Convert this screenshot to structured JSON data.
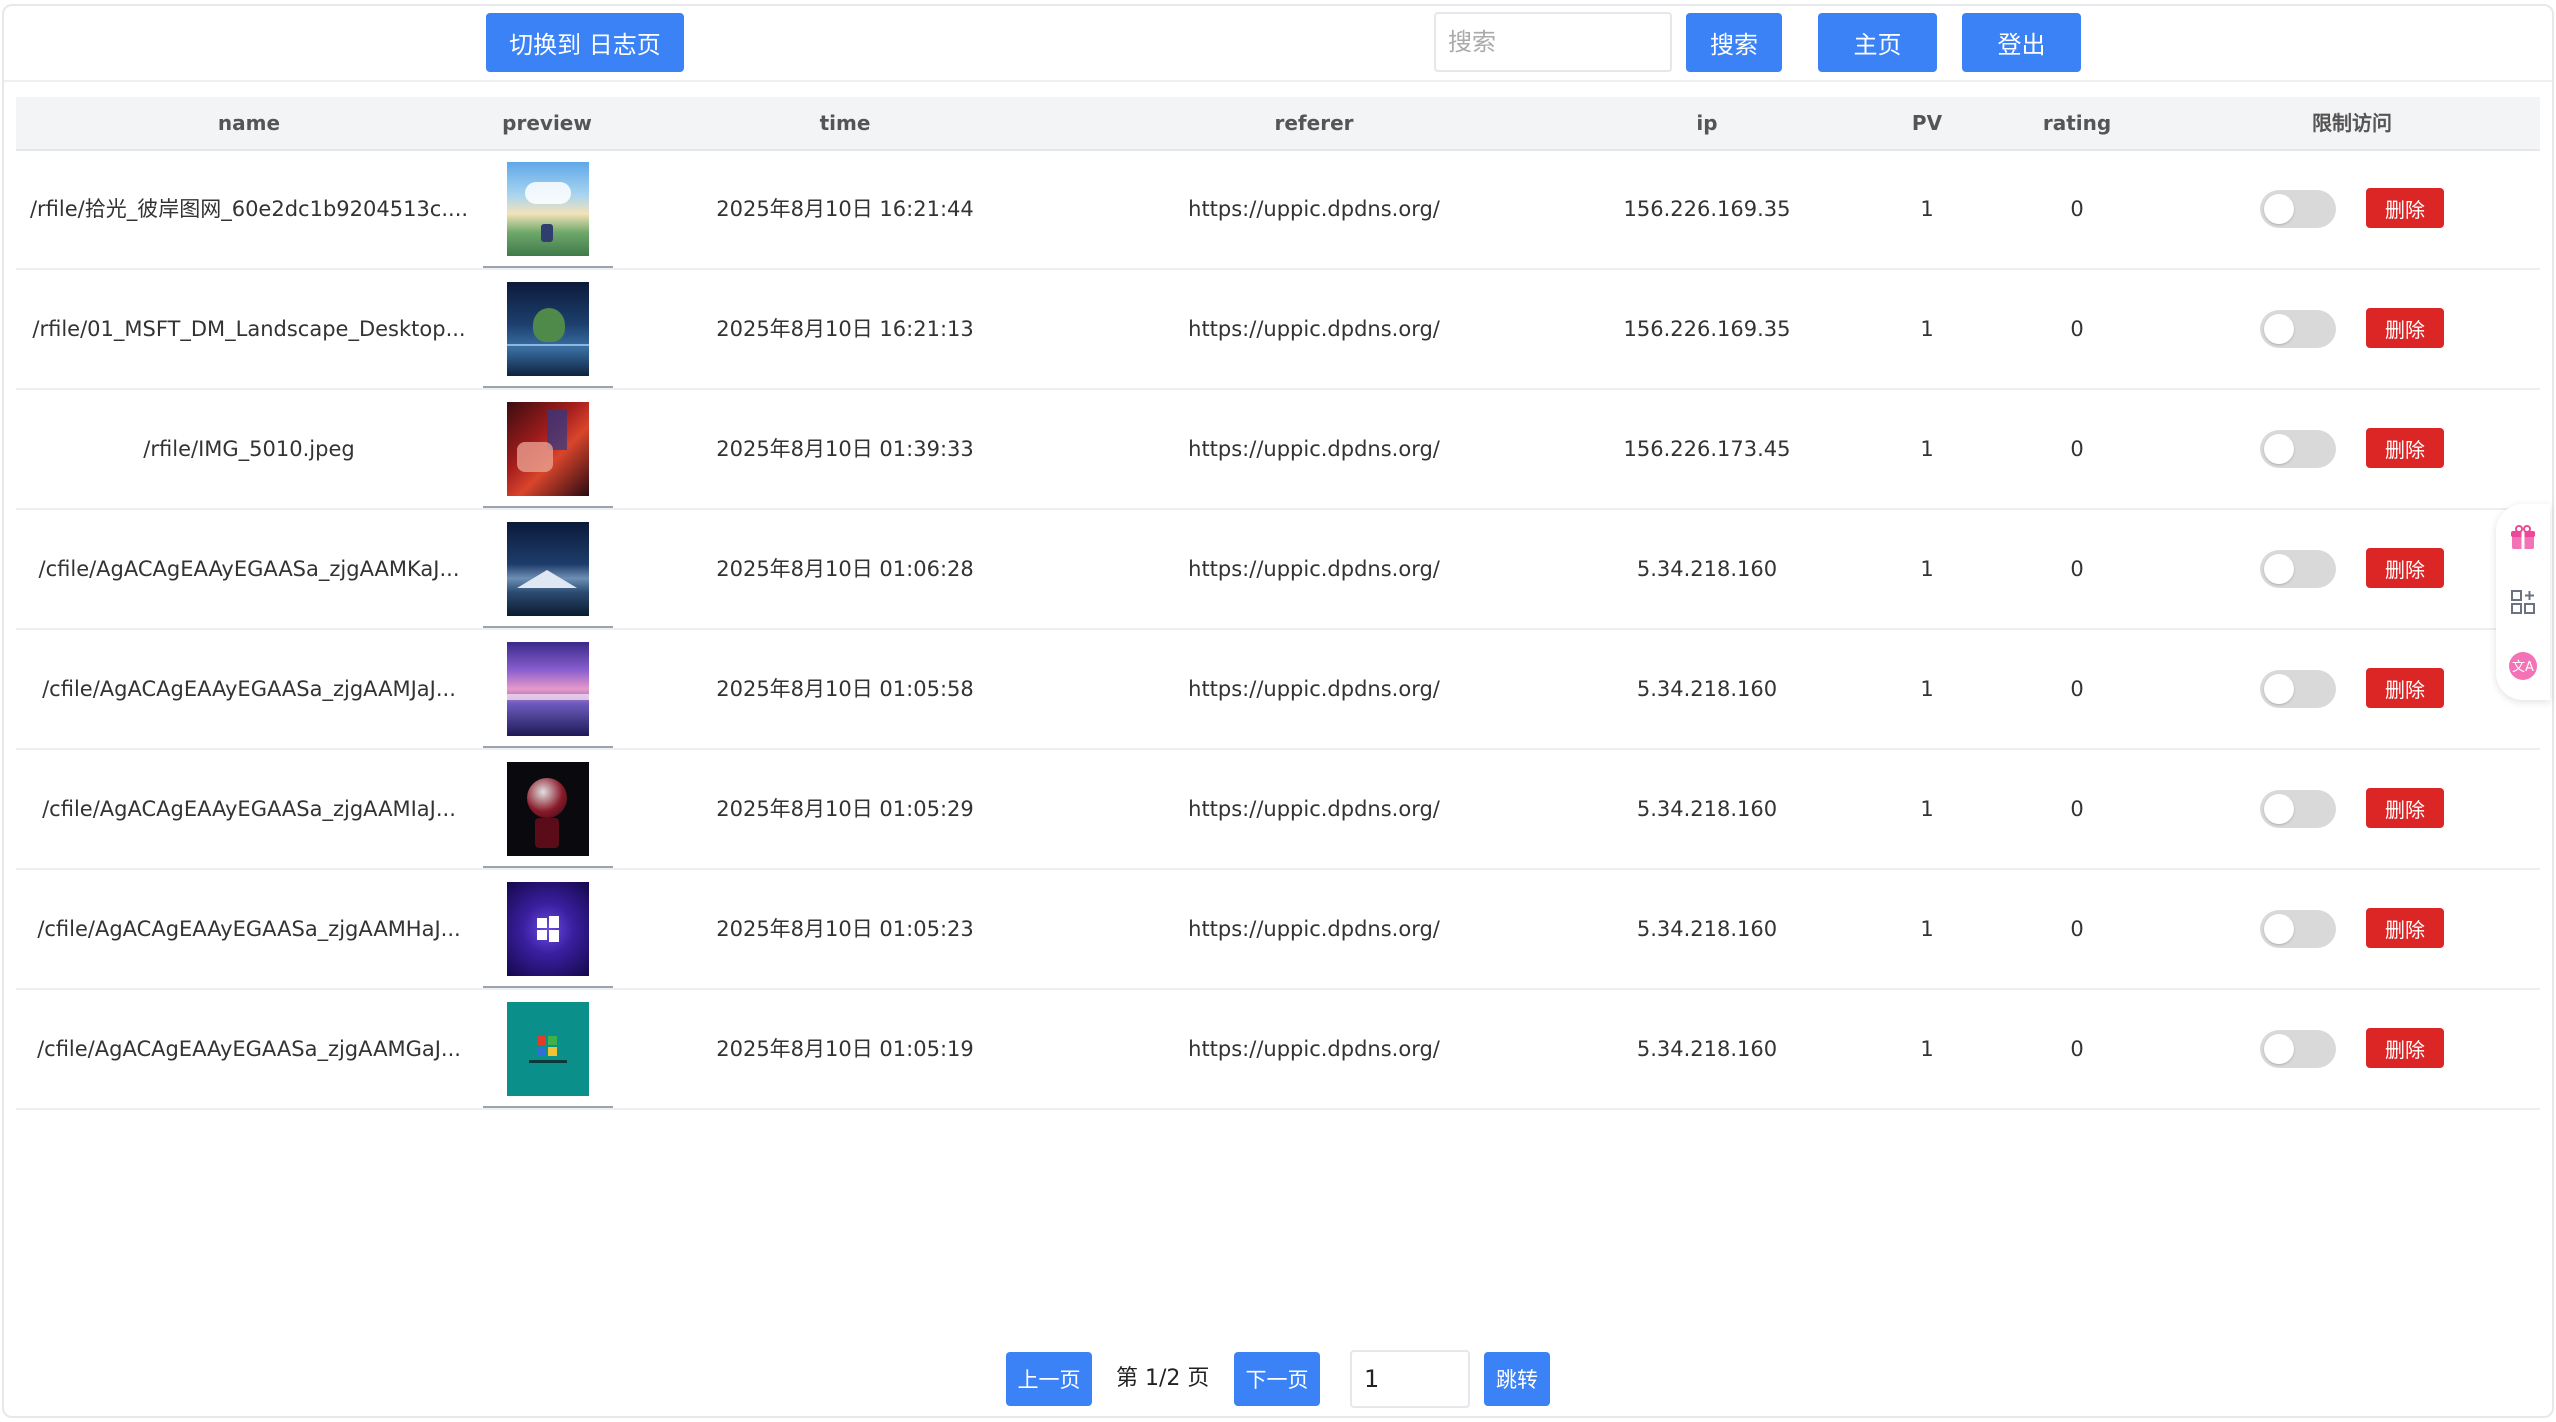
{
  "toolbar": {
    "switch_label": "切换到 日志页",
    "search_placeholder": "搜索",
    "search_label": "搜索",
    "home_label": "主页",
    "logout_label": "登出"
  },
  "table": {
    "columns": [
      "name",
      "preview",
      "time",
      "referer",
      "ip",
      "PV",
      "rating",
      "限制访问"
    ],
    "delete_label": "删除",
    "rows": [
      {
        "name": "/rfile/拾光_彼岸图网_60e2dc1b9204513c....",
        "time": "2025年8月10日 16:21:44",
        "referer": "https://uppic.dpdns.org/",
        "ip": "156.226.169.35",
        "pv": "1",
        "rating": "0",
        "restricted": false
      },
      {
        "name": "/rfile/01_MSFT_DM_Landscape_Desktop...",
        "time": "2025年8月10日 16:21:13",
        "referer": "https://uppic.dpdns.org/",
        "ip": "156.226.169.35",
        "pv": "1",
        "rating": "0",
        "restricted": false
      },
      {
        "name": "/rfile/IMG_5010.jpeg",
        "time": "2025年8月10日 01:39:33",
        "referer": "https://uppic.dpdns.org/",
        "ip": "156.226.173.45",
        "pv": "1",
        "rating": "0",
        "restricted": false
      },
      {
        "name": "/cfile/AgACAgEAAyEGAASa_zjgAAMKaJ...",
        "time": "2025年8月10日 01:06:28",
        "referer": "https://uppic.dpdns.org/",
        "ip": "5.34.218.160",
        "pv": "1",
        "rating": "0",
        "restricted": false
      },
      {
        "name": "/cfile/AgACAgEAAyEGAASa_zjgAAMJaJ...",
        "time": "2025年8月10日 01:05:58",
        "referer": "https://uppic.dpdns.org/",
        "ip": "5.34.218.160",
        "pv": "1",
        "rating": "0",
        "restricted": false
      },
      {
        "name": "/cfile/AgACAgEAAyEGAASa_zjgAAMIaJ...",
        "time": "2025年8月10日 01:05:29",
        "referer": "https://uppic.dpdns.org/",
        "ip": "5.34.218.160",
        "pv": "1",
        "rating": "0",
        "restricted": false
      },
      {
        "name": "/cfile/AgACAgEAAyEGAASa_zjgAAMHaJ...",
        "time": "2025年8月10日 01:05:23",
        "referer": "https://uppic.dpdns.org/",
        "ip": "5.34.218.160",
        "pv": "1",
        "rating": "0",
        "restricted": false
      },
      {
        "name": "/cfile/AgACAgEAAyEGAASa_zjgAAMGaJ...",
        "time": "2025年8月10日 01:05:19",
        "referer": "https://uppic.dpdns.org/",
        "ip": "5.34.218.160",
        "pv": "1",
        "rating": "0",
        "restricted": false
      }
    ]
  },
  "pagination": {
    "prev_label": "上一页",
    "page_text": "第 1/2 页",
    "next_label": "下一页",
    "jump_value": "1",
    "jump_label": "跳转"
  },
  "colors": {
    "primary": "#3b82f6",
    "danger": "#dc2626",
    "header_bg": "#f3f4f6",
    "toggle_off": "#d9d9d9"
  },
  "side_float": {
    "icons": [
      "gift-icon",
      "qr-grid-icon",
      "translate-icon"
    ]
  }
}
